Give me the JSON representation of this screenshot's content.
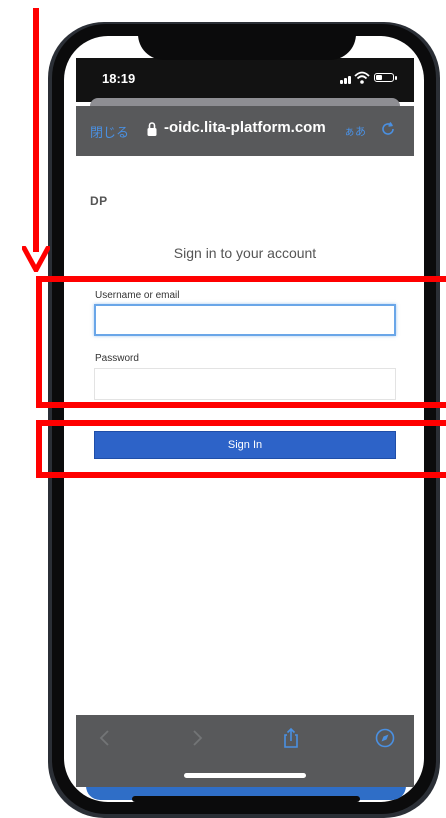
{
  "status_bar": {
    "time": "18:19"
  },
  "browser": {
    "close_label": "閉じる",
    "url": "-oidc.lita-platform.com",
    "text_size_label": "ぁあ",
    "accent_color": "#4a90e2",
    "bar_color": "#58595b"
  },
  "page": {
    "brand": "DP",
    "title": "Sign in to your account",
    "username_label": "Username or email",
    "username_value": "",
    "password_label": "Password",
    "password_value": "",
    "signin_label": "Sign In",
    "button_color": "#2d63c8"
  },
  "toolbar": {
    "icons": [
      "back-icon",
      "forward-icon",
      "share-icon",
      "compass-icon"
    ]
  },
  "annotation": {
    "color": "#ff0000"
  }
}
